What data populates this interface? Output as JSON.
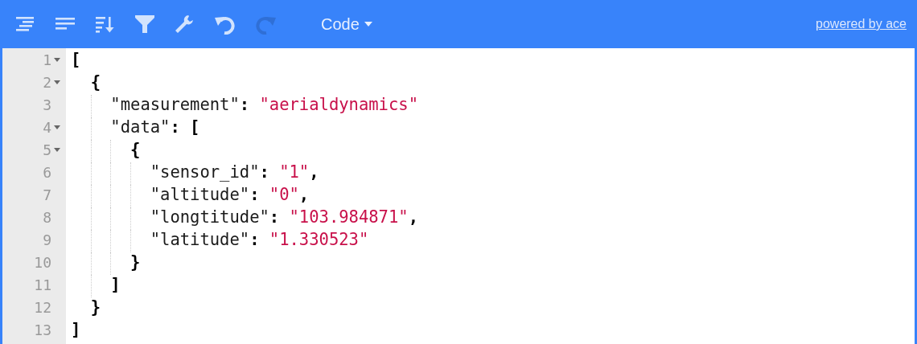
{
  "toolbar": {
    "buttons": [
      {
        "kind": "format",
        "disabled": false
      },
      {
        "kind": "compact",
        "disabled": false
      },
      {
        "kind": "sort",
        "disabled": false
      },
      {
        "kind": "filter",
        "disabled": false
      },
      {
        "kind": "repair",
        "disabled": false
      },
      {
        "kind": "undo",
        "disabled": false
      },
      {
        "kind": "redo",
        "disabled": true
      }
    ],
    "mode_menu": {
      "label": "Code"
    },
    "link": "powered by ace"
  },
  "editor": {
    "lines": [
      {
        "number": "1",
        "tokens": [
          {
            "kind": "punct",
            "text": "["
          }
        ],
        "children": [
          {
            "number": "2",
            "tokens": [
              {
                "kind": "punct",
                "text": "{"
              }
            ],
            "children": [
              {
                "number": "3",
                "tokens": [
                  {
                    "kind": "key",
                    "text": "\"measurement\""
                  },
                  {
                    "kind": "punct",
                    "text": ": "
                  },
                  {
                    "kind": "string",
                    "text": "\"aerialdynamics\""
                  }
                ]
              },
              {
                "number": "4",
                "tokens": [
                  {
                    "kind": "key",
                    "text": "\"data\""
                  },
                  {
                    "kind": "punct",
                    "text": ": ["
                  }
                ],
                "children": [
                  {
                    "number": "5",
                    "tokens": [
                      {
                        "kind": "punct",
                        "text": "{"
                      }
                    ],
                    "children": [
                      {
                        "number": "6",
                        "tokens": [
                          {
                            "kind": "key",
                            "text": "\"sensor_id\""
                          },
                          {
                            "kind": "punct",
                            "text": ": "
                          },
                          {
                            "kind": "string",
                            "text": "\"1\""
                          },
                          {
                            "kind": "punct",
                            "text": ","
                          }
                        ]
                      },
                      {
                        "number": "7",
                        "tokens": [
                          {
                            "kind": "key",
                            "text": "\"altitude\""
                          },
                          {
                            "kind": "punct",
                            "text": ": "
                          },
                          {
                            "kind": "string",
                            "text": "\"0\""
                          },
                          {
                            "kind": "punct",
                            "text": ","
                          }
                        ]
                      },
                      {
                        "number": "8",
                        "tokens": [
                          {
                            "kind": "key",
                            "text": "\"longtitude\""
                          },
                          {
                            "kind": "punct",
                            "text": ": "
                          },
                          {
                            "kind": "string",
                            "text": "\"103.984871\""
                          },
                          {
                            "kind": "punct",
                            "text": ","
                          }
                        ]
                      },
                      {
                        "number": "9",
                        "tokens": [
                          {
                            "kind": "key",
                            "text": "\"latitude\""
                          },
                          {
                            "kind": "punct",
                            "text": ": "
                          },
                          {
                            "kind": "string",
                            "text": "\"1.330523\""
                          }
                        ]
                      }
                    ]
                  },
                  {
                    "number": "10",
                    "tokens": [
                      {
                        "kind": "punct",
                        "text": "}"
                      }
                    ]
                  }
                ]
              },
              {
                "number": "11",
                "tokens": [
                  {
                    "kind": "punct",
                    "text": "]"
                  }
                ]
              }
            ]
          },
          {
            "number": "12",
            "tokens": [
              {
                "kind": "punct",
                "text": "}"
              }
            ]
          }
        ]
      },
      {
        "number": "13",
        "tokens": [
          {
            "kind": "punct",
            "text": "]"
          }
        ]
      }
    ]
  }
}
